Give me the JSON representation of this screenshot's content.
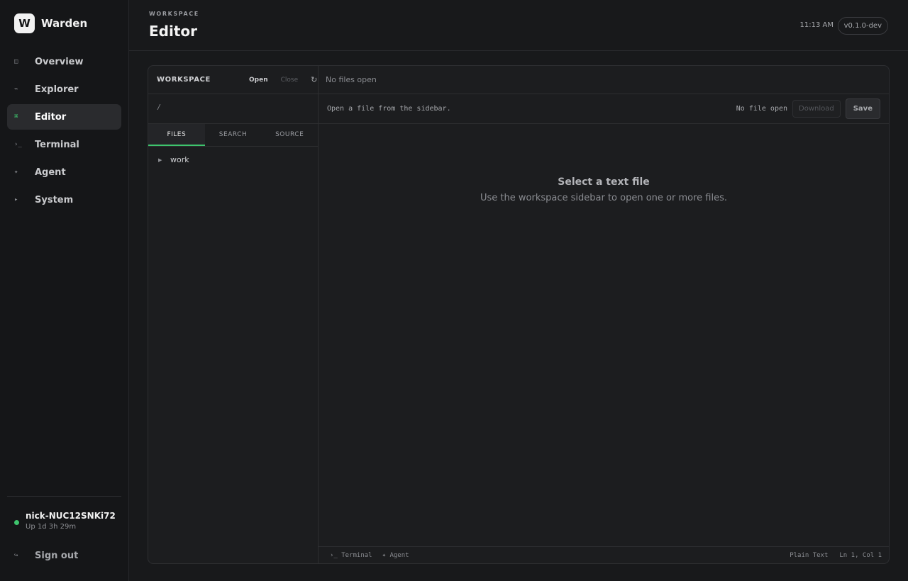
{
  "app": {
    "logo_letter": "W",
    "name": "Warden"
  },
  "nav": {
    "items": [
      {
        "icon": "◫",
        "label": "Overview"
      },
      {
        "icon": "⌁",
        "label": "Explorer"
      },
      {
        "icon": "⌘",
        "label": "Editor",
        "active": true
      },
      {
        "icon": "›_",
        "label": "Terminal"
      },
      {
        "icon": "✦",
        "label": "Agent"
      },
      {
        "icon": "▸",
        "label": "System"
      }
    ],
    "signout": {
      "icon": "↪",
      "label": "Sign out"
    }
  },
  "host": {
    "name": "nick-NUC12SNKi72",
    "uptime": "Up 1d 3h 29m",
    "status_color": "#3ec46d"
  },
  "header": {
    "eyebrow": "WORKSPACE",
    "title": "Editor",
    "time": "11:13 AM",
    "version": "v0.1.0-dev"
  },
  "workspace": {
    "title": "WORKSPACE",
    "open_label": "Open",
    "close_label": "Close",
    "refresh_icon": "↻",
    "path": "/",
    "tabs": [
      "FILES",
      "SEARCH",
      "SOURCE"
    ],
    "active_tab": "FILES",
    "tree": [
      {
        "caret": "▶",
        "label": "work"
      }
    ]
  },
  "editor": {
    "tabs_empty": "No files open",
    "hint": "Open a file from the sidebar.",
    "status": "No file open",
    "download_label": "Download",
    "save_label": "Save",
    "empty_title": "Select a text file",
    "empty_subtitle": "Use the workspace sidebar to open one or more files.",
    "footer": {
      "terminal_label": "›_ Terminal",
      "agent_label": "✦ Agent",
      "language": "Plain Text",
      "cursor": "Ln 1, Col 1"
    }
  },
  "colors": {
    "accent": "#3ec46d",
    "background": "#18191b",
    "panel": "#1c1d1f"
  }
}
